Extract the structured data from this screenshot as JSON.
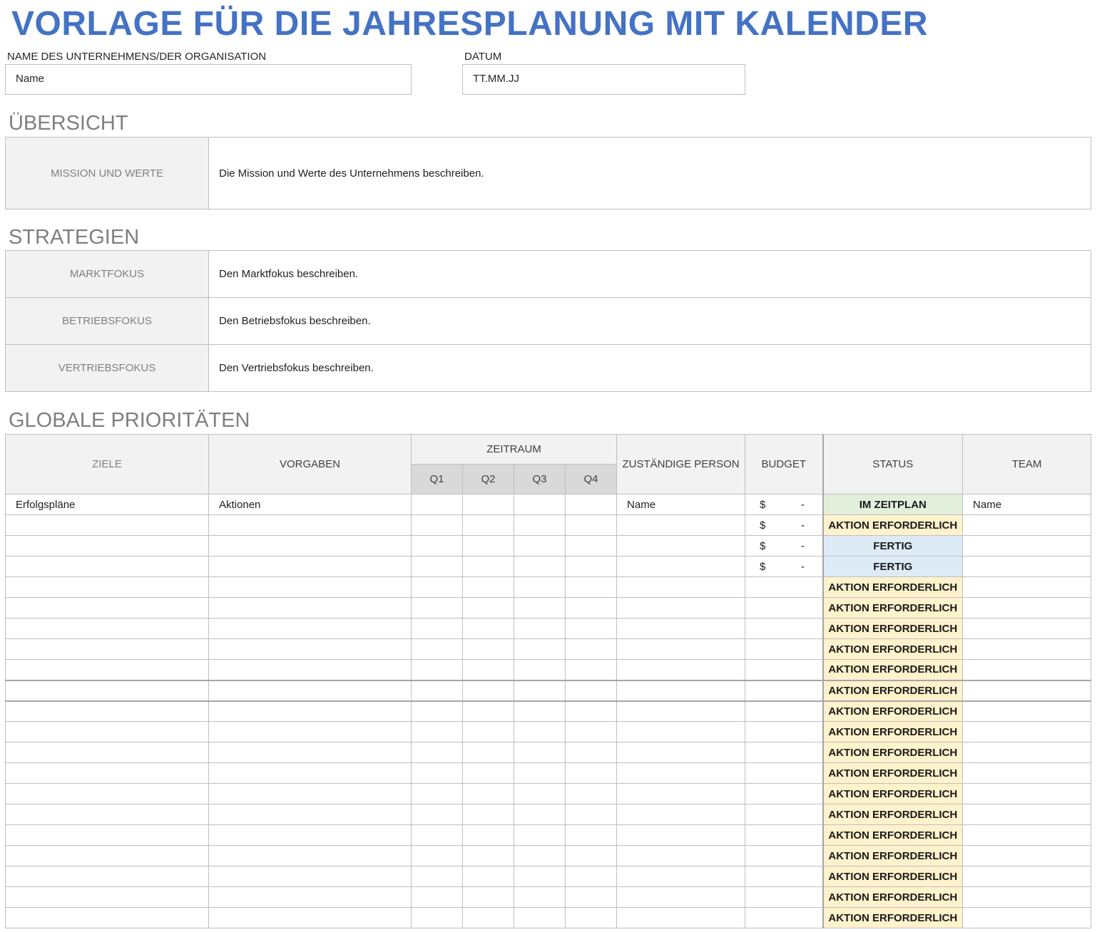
{
  "title": "VORLAGE FÜR DIE JAHRESPLANUNG MIT KALENDER",
  "org": {
    "label": "NAME DES UNTERNEHMENS/DER ORGANISATION",
    "value": "Name"
  },
  "date": {
    "label": "DATUM",
    "value": "TT.MM.JJ"
  },
  "overview": {
    "heading": "ÜBERSICHT",
    "rows": [
      {
        "label": "MISSION UND WERTE",
        "text": "Die Mission und Werte des Unternehmens beschreiben."
      }
    ]
  },
  "strategies": {
    "heading": "STRATEGIEN",
    "rows": [
      {
        "label": "MARKTFOKUS",
        "text": "Den Marktfokus beschreiben."
      },
      {
        "label": "BETRIEBSFOKUS",
        "text": "Den Betriebsfokus beschreiben."
      },
      {
        "label": "VERTRIEBSFOKUS",
        "text": "Den Vertriebsfokus beschreiben."
      }
    ]
  },
  "priorities": {
    "heading": "GLOBALE PRIORITÄTEN",
    "headers": {
      "goals": "ZIELE",
      "objectives": "VORGABEN",
      "period": "ZEITRAUM",
      "q1": "Q1",
      "q2": "Q2",
      "q3": "Q3",
      "q4": "Q4",
      "owner": "ZUSTÄNDIGE PERSON",
      "budget": "BUDGET",
      "status": "STATUS",
      "team": "TEAM"
    },
    "rows": [
      {
        "goal": "Erfolgspläne",
        "objective": "Aktionen",
        "owner": "Name",
        "currency": "$",
        "budget": "-",
        "status": "IM ZEITPLAN",
        "team": "Name"
      },
      {
        "goal": "",
        "objective": "",
        "owner": "",
        "currency": "$",
        "budget": "-",
        "status": "AKTION ERFORDERLICH",
        "team": ""
      },
      {
        "goal": "",
        "objective": "",
        "owner": "",
        "currency": "$",
        "budget": "-",
        "status": "FERTIG",
        "team": ""
      },
      {
        "goal": "",
        "objective": "",
        "owner": "",
        "currency": "$",
        "budget": "-",
        "status": "FERTIG",
        "team": ""
      },
      {
        "goal": "",
        "objective": "",
        "owner": "",
        "currency": "",
        "budget": "",
        "status": "AKTION ERFORDERLICH",
        "team": ""
      },
      {
        "goal": "",
        "objective": "",
        "owner": "",
        "currency": "",
        "budget": "",
        "status": "AKTION ERFORDERLICH",
        "team": ""
      },
      {
        "goal": "",
        "objective": "",
        "owner": "",
        "currency": "",
        "budget": "",
        "status": "AKTION ERFORDERLICH",
        "team": ""
      },
      {
        "goal": "",
        "objective": "",
        "owner": "",
        "currency": "",
        "budget": "",
        "status": "AKTION ERFORDERLICH",
        "team": ""
      },
      {
        "goal": "",
        "objective": "",
        "owner": "",
        "currency": "",
        "budget": "",
        "status": "AKTION ERFORDERLICH",
        "team": ""
      },
      {
        "goal": "",
        "objective": "",
        "owner": "",
        "currency": "",
        "budget": "",
        "status": "AKTION ERFORDERLICH",
        "team": ""
      },
      {
        "goal": "",
        "objective": "",
        "owner": "",
        "currency": "",
        "budget": "",
        "status": "AKTION ERFORDERLICH",
        "team": ""
      },
      {
        "goal": "",
        "objective": "",
        "owner": "",
        "currency": "",
        "budget": "",
        "status": "AKTION ERFORDERLICH",
        "team": ""
      },
      {
        "goal": "",
        "objective": "",
        "owner": "",
        "currency": "",
        "budget": "",
        "status": "AKTION ERFORDERLICH",
        "team": ""
      },
      {
        "goal": "",
        "objective": "",
        "owner": "",
        "currency": "",
        "budget": "",
        "status": "AKTION ERFORDERLICH",
        "team": ""
      },
      {
        "goal": "",
        "objective": "",
        "owner": "",
        "currency": "",
        "budget": "",
        "status": "AKTION ERFORDERLICH",
        "team": ""
      },
      {
        "goal": "",
        "objective": "",
        "owner": "",
        "currency": "",
        "budget": "",
        "status": "AKTION ERFORDERLICH",
        "team": ""
      },
      {
        "goal": "",
        "objective": "",
        "owner": "",
        "currency": "",
        "budget": "",
        "status": "AKTION ERFORDERLICH",
        "team": ""
      },
      {
        "goal": "",
        "objective": "",
        "owner": "",
        "currency": "",
        "budget": "",
        "status": "AKTION ERFORDERLICH",
        "team": ""
      },
      {
        "goal": "",
        "objective": "",
        "owner": "",
        "currency": "",
        "budget": "",
        "status": "AKTION ERFORDERLICH",
        "team": ""
      },
      {
        "goal": "",
        "objective": "",
        "owner": "",
        "currency": "",
        "budget": "",
        "status": "AKTION ERFORDERLICH",
        "team": ""
      },
      {
        "goal": "",
        "objective": "",
        "owner": "",
        "currency": "",
        "budget": "",
        "status": "AKTION ERFORDERLICH",
        "team": ""
      }
    ]
  }
}
